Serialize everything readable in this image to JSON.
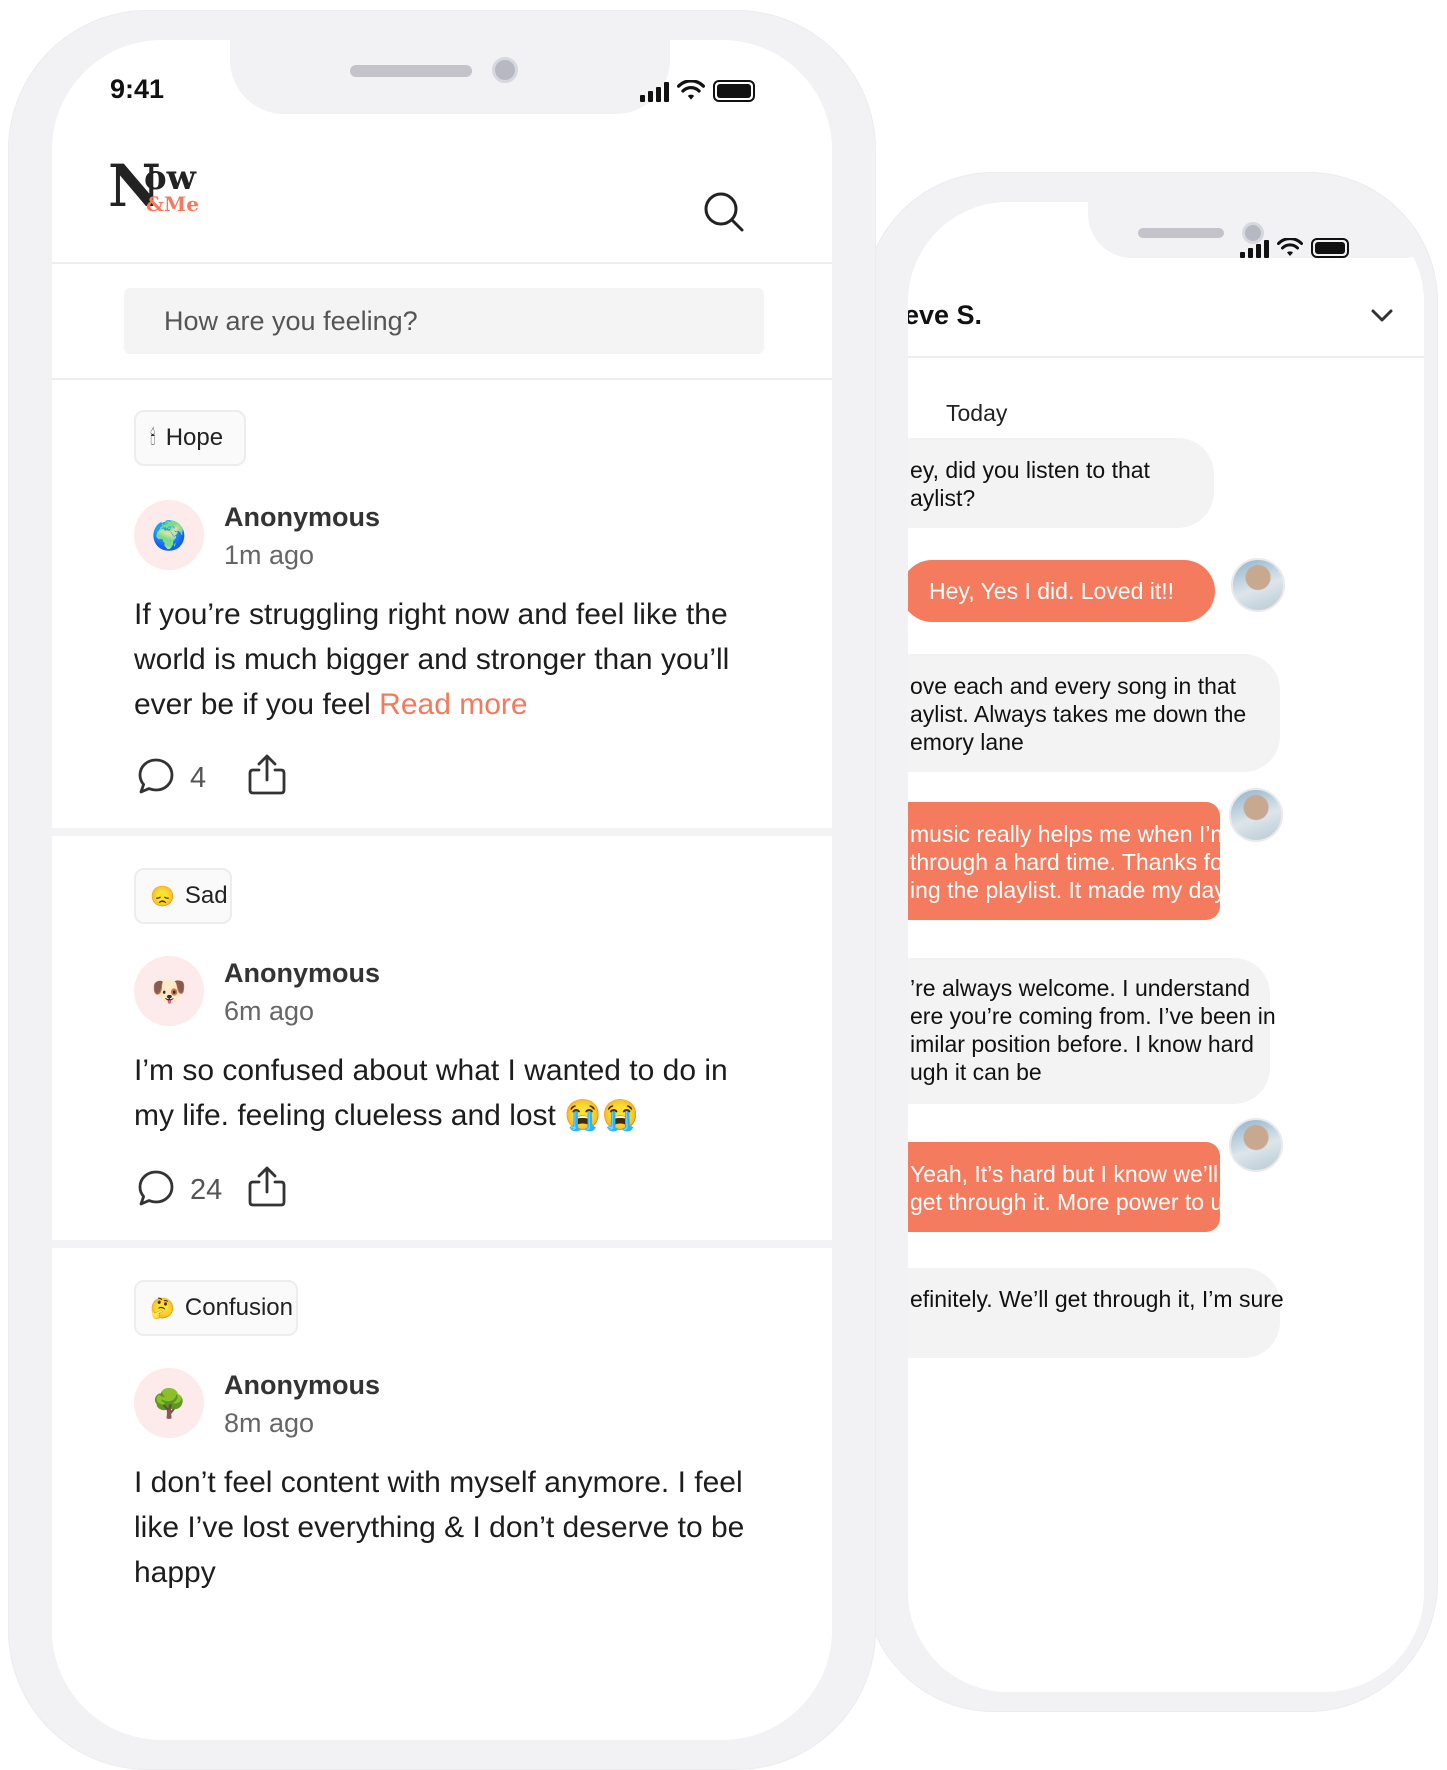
{
  "front_phone": {
    "status_bar": {
      "time": "9:41"
    },
    "header": {
      "logo_text": "Now",
      "logo_sub": "&Me"
    },
    "search": {
      "placeholder": "How are you feeling?"
    },
    "posts": [
      {
        "mood": "Hope",
        "mood_emoji": "🕯",
        "avatar_emoji": "🌍",
        "author": "Anonymous",
        "time_ago": "1m ago",
        "text": "If you’re struggling right now and feel like the world is much bigger and stronger than you’ll ever be if you feel ",
        "read_more": "Read more",
        "comments": "4"
      },
      {
        "mood": "Sad",
        "mood_emoji": "😞",
        "avatar_emoji": "🐶",
        "author": "Anonymous",
        "time_ago": "6m ago",
        "text": "I’m so confused about what I wanted to do in my life. feeling clueless and lost 😭😭",
        "comments": "24"
      },
      {
        "mood": "Confusion",
        "mood_emoji": "🤔",
        "avatar_emoji": "🌳",
        "author": "Anonymous",
        "time_ago": "8m ago",
        "text": "I don’t feel content with myself anymore. I feel like I’ve lost everything & I don’t deserve to be happy"
      }
    ]
  },
  "back_phone": {
    "chat": {
      "contact_name": "Steve S.",
      "date_label": "Today",
      "messages": [
        {
          "direction": "incoming",
          "text": "ey, did you listen to that\naylist?"
        },
        {
          "direction": "outgoing",
          "text": "Hey, Yes I did. Loved it!!"
        },
        {
          "direction": "incoming",
          "text": "ove each and every song in that\naylist. Always takes me down the\nemory lane"
        },
        {
          "direction": "outgoing",
          "text": "music really helps me when I’m\nthrough a hard time. Thanks for\ning the playlist. It made my day."
        },
        {
          "direction": "incoming",
          "text": "’re always welcome. I understand\nere you’re coming from. I’ve been in\nimilar position before. I know hard\nugh it can be"
        },
        {
          "direction": "outgoing",
          "text": "Yeah, It’s hard but I know we’ll\nget through it. More power to us"
        },
        {
          "direction": "incoming",
          "text": "efinitely. We’ll get through it, I’m sure"
        }
      ]
    }
  },
  "colors": {
    "accent": "#f47b5e",
    "avatar_bg": "#fdeaea",
    "bubble_in": "#f3f3f3",
    "frame": "#f2f2f4"
  }
}
